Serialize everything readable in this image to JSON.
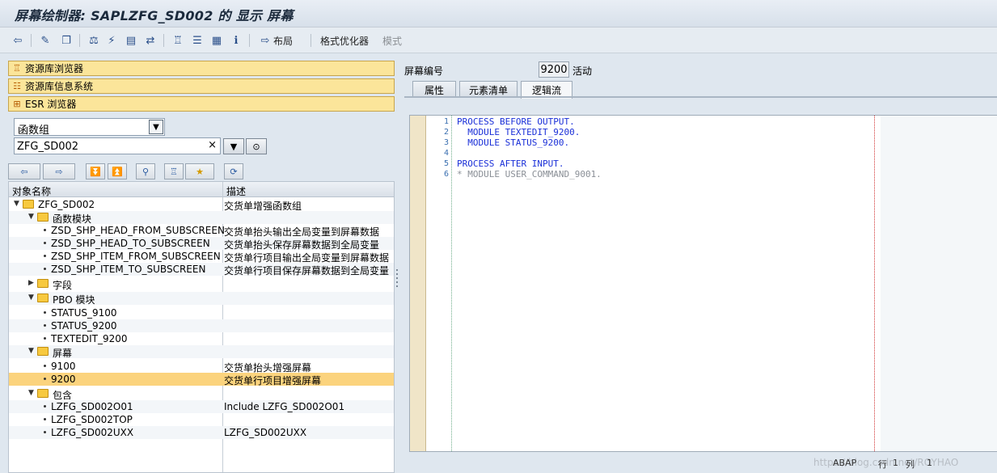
{
  "window": {
    "title": "屏幕绘制器: SAPLZFG_SD002 的 显示 屏幕"
  },
  "toolbar": {
    "icons": [
      "back-icon",
      "display-change-icon",
      "other-object-icon",
      "check-icon",
      "activate-icon",
      "test-icon",
      "where-used-icon",
      "navigate-icon",
      "hierarchy-icon",
      "display-object-list-icon",
      "element-list-icon",
      "info-icon"
    ],
    "layout_label": "布局",
    "format_label": "格式优化器",
    "mode_label": "模式"
  },
  "nav": {
    "repo_browser": "资源库浏览器",
    "repo_info": "资源库信息系统",
    "esr_browser": "ESR 浏览器"
  },
  "selector": {
    "object_type": "函数组",
    "object_name": "ZFG_SD002",
    "clear_glyph": "×"
  },
  "tree": {
    "col_name": "对象名称",
    "col_desc": "描述",
    "rows": [
      {
        "name": "ZFG_SD002",
        "desc": "交货单增强函数组"
      },
      {
        "name": "函数模块",
        "desc": ""
      },
      {
        "name": "ZSD_SHP_HEAD_FROM_SUBSCREEN",
        "desc": "交货单抬头输出全局变量到屏幕数据"
      },
      {
        "name": "ZSD_SHP_HEAD_TO_SUBSCREEN",
        "desc": "交货单抬头保存屏幕数据到全局变量"
      },
      {
        "name": "ZSD_SHP_ITEM_FROM_SUBSCREEN",
        "desc": "交货单行项目输出全局变量到屏幕数据"
      },
      {
        "name": "ZSD_SHP_ITEM_TO_SUBSCREEN",
        "desc": "交货单行项目保存屏幕数据到全局变量"
      },
      {
        "name": "字段",
        "desc": ""
      },
      {
        "name": "PBO 模块",
        "desc": ""
      },
      {
        "name": "STATUS_9100",
        "desc": ""
      },
      {
        "name": "STATUS_9200",
        "desc": ""
      },
      {
        "name": "TEXTEDIT_9200",
        "desc": ""
      },
      {
        "name": "屏幕",
        "desc": ""
      },
      {
        "name": "9100",
        "desc": "交货单抬头增强屏幕"
      },
      {
        "name": "9200",
        "desc": "交货单行项目增强屏幕"
      },
      {
        "name": "包含",
        "desc": ""
      },
      {
        "name": "LZFG_SD002O01",
        "desc": "Include LZFG_SD002O01"
      },
      {
        "name": "LZFG_SD002TOP",
        "desc": ""
      },
      {
        "name": "LZFG_SD002UXX",
        "desc": "LZFG_SD002UXX"
      }
    ]
  },
  "screen": {
    "label": "屏幕编号",
    "number": "9200",
    "status": "活动",
    "tabs": [
      "属性",
      "元素清单",
      "逻辑流"
    ]
  },
  "code": {
    "line_numbers": [
      "1",
      "2",
      "3",
      "4",
      "5",
      "6"
    ],
    "lines": [
      "PROCESS BEFORE OUTPUT.",
      "  MODULE TEXTEDIT_9200.",
      "  MODULE STATUS_9200.",
      "",
      "PROCESS AFTER INPUT.",
      "* MODULE USER_COMMAND_9001."
    ]
  },
  "status": {
    "language": "ABAP",
    "row_label": "行",
    "row_value": "1",
    "col_label": "列",
    "col_value": "1",
    "watermark": "https://blog.csdn.net/ROYHAO"
  },
  "colors": {
    "nav_button": "#fbe59a",
    "selected_row": "#fbd37d",
    "keyword": "#1a2fd8",
    "comment": "#8a8f96"
  }
}
